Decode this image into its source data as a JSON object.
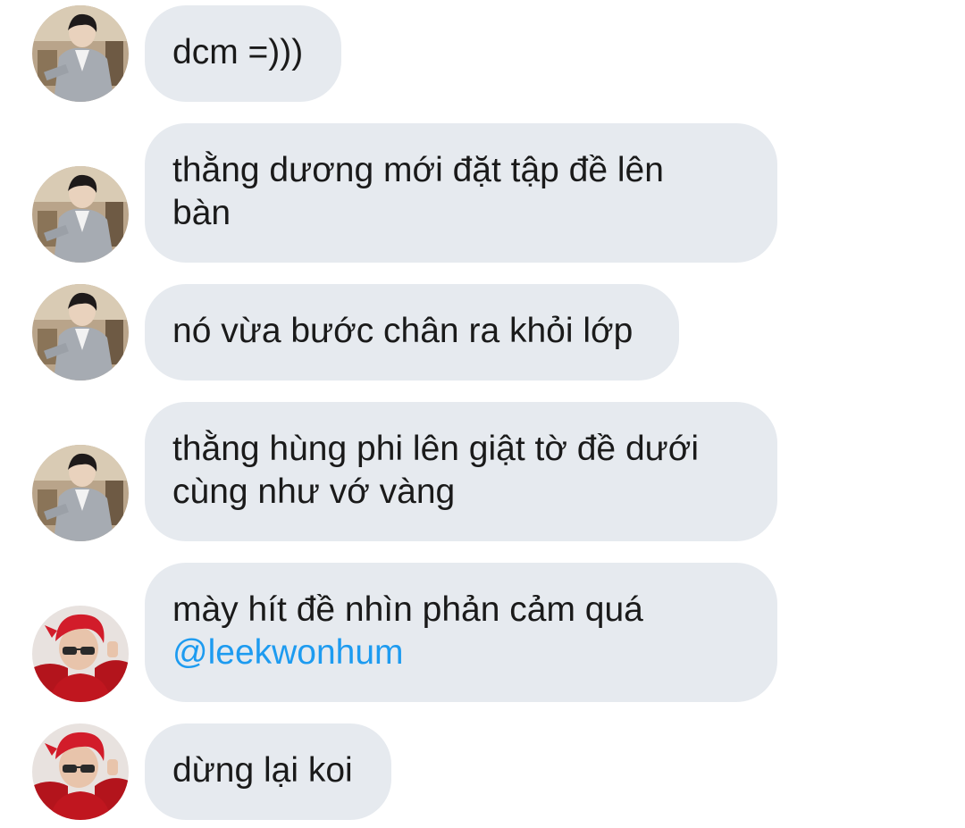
{
  "messages": [
    {
      "sender": "user-a",
      "lines": [
        "dcm =)))"
      ]
    },
    {
      "sender": "user-a",
      "lines": [
        "thằng dương mới đặt tập đề lên",
        "bàn"
      ]
    },
    {
      "sender": "user-a",
      "lines": [
        "nó vừa bước chân ra khỏi lớp"
      ]
    },
    {
      "sender": "user-a",
      "lines": [
        "thằng hùng phi lên giật tờ đề dưới",
        "cùng như vớ vàng"
      ]
    },
    {
      "sender": "user-b",
      "lines": [
        "mày hít đề nhìn phản cảm quá"
      ],
      "mention": "@leekwonhum"
    },
    {
      "sender": "user-b",
      "lines": [
        "dừng lại koi"
      ]
    }
  ],
  "colors": {
    "bubble_bg": "#e6eaef",
    "text": "#1a1a1a",
    "mention": "#1d9bf0",
    "page_bg": "#ffffff"
  },
  "icons": {
    "avatar_a": "avatar-grey-cardigan",
    "avatar_b": "avatar-red-hair-sunglasses"
  }
}
